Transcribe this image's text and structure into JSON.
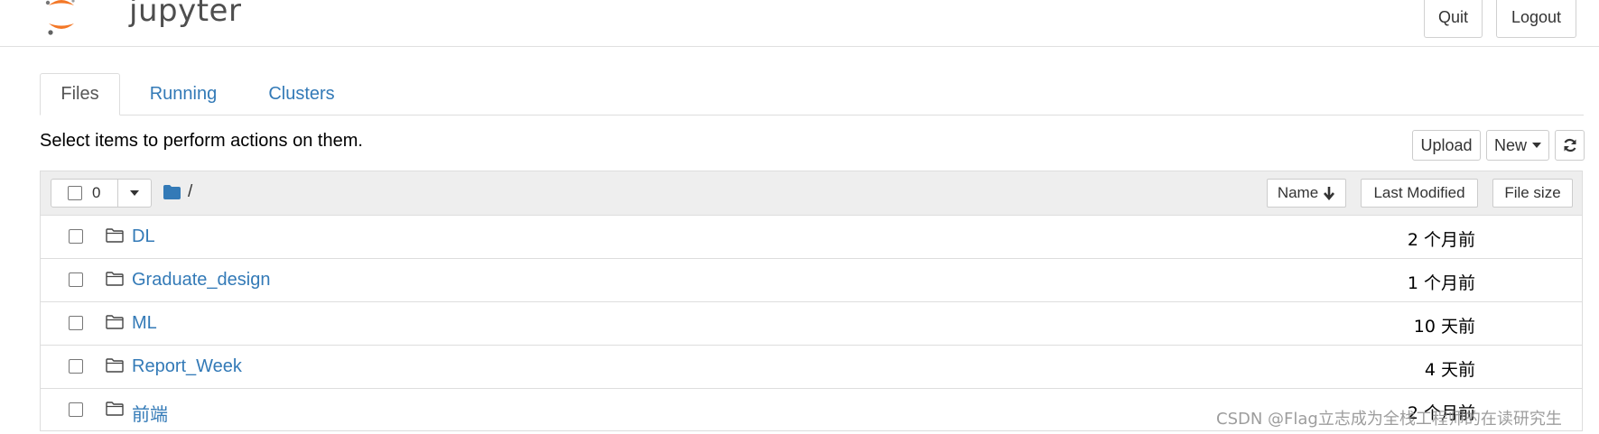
{
  "header": {
    "logo_text": "jupyter",
    "quit_label": "Quit",
    "logout_label": "Logout"
  },
  "tabs": [
    {
      "label": "Files",
      "active": true
    },
    {
      "label": "Running",
      "active": false
    },
    {
      "label": "Clusters",
      "active": false
    }
  ],
  "toolbar": {
    "instructions": "Select items to perform actions on them.",
    "upload_label": "Upload",
    "new_label": "New",
    "refresh_icon": "refresh-icon"
  },
  "list_header": {
    "selected_count": "0",
    "breadcrumb": "/",
    "sort_name_label": "Name",
    "sort_modified_label": "Last Modified",
    "sort_size_label": "File size"
  },
  "items": [
    {
      "name": "DL",
      "modified": "2 个月前",
      "icon": "folder-icon"
    },
    {
      "name": "Graduate_design",
      "modified": "1 个月前",
      "icon": "folder-icon"
    },
    {
      "name": "ML",
      "modified": "10 天前",
      "icon": "folder-icon"
    },
    {
      "name": "Report_Week",
      "modified": "4 天前",
      "icon": "folder-icon"
    },
    {
      "name": "前端",
      "modified": "2 个月前",
      "icon": "folder-icon"
    }
  ],
  "watermark": "CSDN @Flag立志成为全栈工程师的在读研究生",
  "colors": {
    "link": "#337ab7",
    "logo_orange": "#f37726",
    "header_bg": "#eeeeee"
  }
}
